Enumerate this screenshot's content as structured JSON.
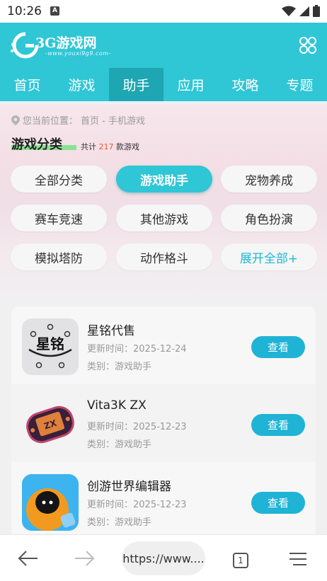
{
  "status_bar": {
    "time": "10:26",
    "notif_letter": "A"
  },
  "header": {
    "logo_title": "3G游戏网",
    "logo_sub": "-www.youxi9g9.com-",
    "menu_icon": "grid-menu-icon"
  },
  "nav": {
    "items": [
      "首页",
      "游戏",
      "助手",
      "应用",
      "攻略",
      "专题"
    ],
    "active_index": 2
  },
  "breadcrumb": {
    "prefix": "您当前位置：",
    "path": "首页 - 手机游戏"
  },
  "section": {
    "title": "游戏分类",
    "total_prefix": "共计 ",
    "total_num": "217",
    "total_suffix": " 款游戏"
  },
  "categories": {
    "items": [
      "全部分类",
      "游戏助手",
      "宠物养成",
      "赛车竞速",
      "其他游戏",
      "角色扮演",
      "模拟塔防",
      "动作格斗",
      "展开全部+"
    ],
    "active_index": 1
  },
  "list": {
    "items": [
      {
        "name": "星铭代售",
        "date": "更新时间：2025-12-24",
        "category": "类别：游戏助手",
        "button": "查看",
        "icon_text": "星铭"
      },
      {
        "name": "Vita3K ZX",
        "date": "更新时间：2025-12-23",
        "category": "类别：游戏助手",
        "button": "查看"
      },
      {
        "name": "创游世界编辑器",
        "date": "更新时间：2025-12-23",
        "category": "类别：游戏助手",
        "button": "查看"
      }
    ]
  },
  "browser": {
    "url": "https://www....",
    "tab_count": "1"
  },
  "colors": {
    "accent": "#2fc6d6",
    "nav_active": "#1ea6b2",
    "button": "#1fb3d6",
    "count": "#f2552c"
  }
}
